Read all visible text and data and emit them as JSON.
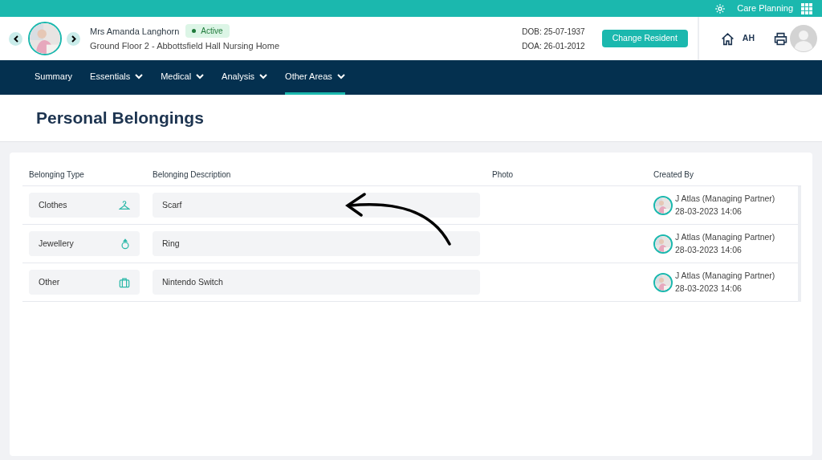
{
  "topbar": {
    "app_name": "Care Planning"
  },
  "resident": {
    "name": "Mrs Amanda Langhorn",
    "status": "Active",
    "location": "Ground Floor 2 - Abbottsfield Hall Nursing Home",
    "dob": "DOB: 25-07-1937",
    "doa": "DOA: 26-01-2012",
    "change_button": "Change Resident"
  },
  "user": {
    "initials": "AH"
  },
  "nav": [
    {
      "label": "Summary",
      "dropdown": false,
      "selected": false
    },
    {
      "label": "Essentials",
      "dropdown": true,
      "selected": false
    },
    {
      "label": "Medical",
      "dropdown": true,
      "selected": false
    },
    {
      "label": "Analysis",
      "dropdown": true,
      "selected": false
    },
    {
      "label": "Other Areas",
      "dropdown": true,
      "selected": true
    }
  ],
  "page_title": "Personal Belongings",
  "table": {
    "columns": [
      "Belonging Type",
      "Belonging Description",
      "Photo",
      "Created By"
    ],
    "rows": [
      {
        "type": "Clothes",
        "kind": "clothes",
        "description": "Scarf",
        "created_by": "J Atlas (Managing Partner)",
        "created_at": "28-03-2023 14:06"
      },
      {
        "type": "Jewellery",
        "kind": "jewellery",
        "description": "Ring",
        "created_by": "J Atlas (Managing Partner)",
        "created_at": "28-03-2023 14:06"
      },
      {
        "type": "Other",
        "kind": "other",
        "description": "Nintendo Switch",
        "created_by": "J Atlas (Managing Partner)",
        "created_at": "28-03-2023 14:06"
      }
    ]
  }
}
